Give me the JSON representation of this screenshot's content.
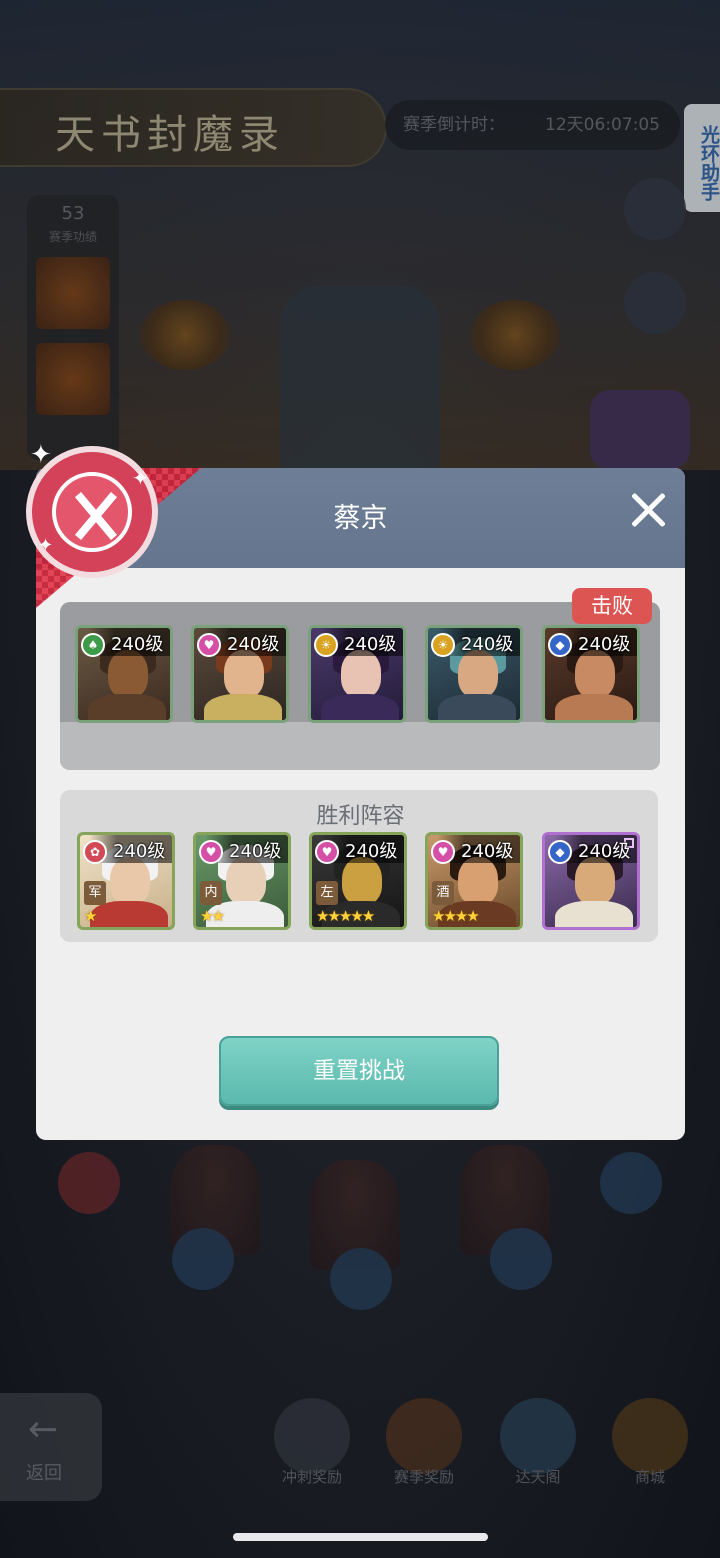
{
  "background": {
    "banner_title": "天书封魔录",
    "season_timer_label": "赛季倒计时：",
    "season_timer_value": "12天06:07:05",
    "helper_tab": "光环助手",
    "left_panel_number": "53",
    "left_panel_label": "赛季功绩",
    "hint_text": "",
    "back_label": "返回",
    "bottom_buttons": [
      "冲刺奖励",
      "赛季奖励",
      "达天阁",
      "商城"
    ]
  },
  "dialog": {
    "title": "蔡京",
    "defeat_badge": "击败",
    "victory_title": "胜利阵容",
    "reset_button": "重置挑战",
    "enemy_team": [
      {
        "level": "240级",
        "faction": "green",
        "faction_icon": "spade-icon"
      },
      {
        "level": "240级",
        "faction": "pink",
        "faction_icon": "heart-gem-icon"
      },
      {
        "level": "240级",
        "faction": "gold",
        "faction_icon": "sun-icon"
      },
      {
        "level": "240级",
        "faction": "gold",
        "faction_icon": "sun-icon"
      },
      {
        "level": "240级",
        "faction": "blue",
        "faction_icon": "diamond-icon"
      }
    ],
    "victory_team": [
      {
        "level": "240级",
        "faction": "red",
        "tag": "军",
        "stars": "★"
      },
      {
        "level": "240级",
        "faction": "pink",
        "tag": "内",
        "stars": "★★"
      },
      {
        "level": "240级",
        "faction": "pink",
        "tag": "左",
        "stars": "★★★★★"
      },
      {
        "level": "240级",
        "faction": "pink",
        "tag": "酒",
        "stars": "★★★★"
      },
      {
        "level": "240级",
        "faction": "blue",
        "tag": "",
        "stars": ""
      }
    ]
  }
}
